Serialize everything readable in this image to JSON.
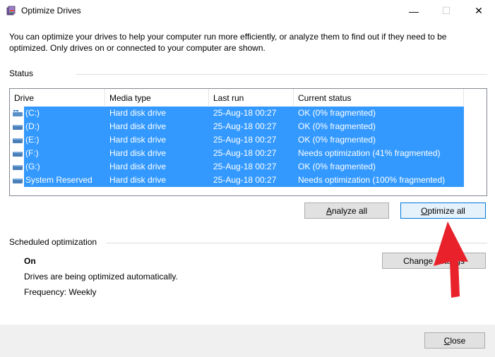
{
  "window": {
    "title": "Optimize Drives",
    "min_glyph": "—",
    "max_glyph": "☐",
    "close_glyph": "✕",
    "accent": "#3399ff",
    "arrow_color": "#e8212b"
  },
  "description": "You can optimize your drives to help your computer run more efficiently, or analyze them to find out if they need to be optimized. Only drives on or connected to your computer are shown.",
  "status": {
    "label": "Status",
    "columns": [
      "Drive",
      "Media type",
      "Last run",
      "Current status"
    ],
    "rows": [
      {
        "drive": "(C:)",
        "media": "Hard disk drive",
        "last_run": "25-Aug-18 00:27",
        "status": "OK (0% fragmented)",
        "icon": "system-drive-icon"
      },
      {
        "drive": "(D:)",
        "media": "Hard disk drive",
        "last_run": "25-Aug-18 00:27",
        "status": "OK (0% fragmented)",
        "icon": "drive-icon"
      },
      {
        "drive": "(E:)",
        "media": "Hard disk drive",
        "last_run": "25-Aug-18 00:27",
        "status": "OK (0% fragmented)",
        "icon": "drive-icon"
      },
      {
        "drive": "(F:)",
        "media": "Hard disk drive",
        "last_run": "25-Aug-18 00:27",
        "status": "Needs optimization (41% fragmented)",
        "icon": "drive-icon"
      },
      {
        "drive": "(G:)",
        "media": "Hard disk drive",
        "last_run": "25-Aug-18 00:27",
        "status": "OK (0% fragmented)",
        "icon": "drive-icon"
      },
      {
        "drive": "System Reserved",
        "media": "Hard disk drive",
        "last_run": "25-Aug-18 00:27",
        "status": "Needs optimization (100% fragmented)",
        "icon": "drive-icon"
      }
    ]
  },
  "buttons": {
    "analyze_all": {
      "accel": "A",
      "rest": "nalyze all"
    },
    "optimize_all": {
      "accel": "O",
      "rest": "ptimize all"
    },
    "change_settings": "Change settings",
    "close": {
      "accel": "C",
      "rest": "lose"
    }
  },
  "scheduled": {
    "label": "Scheduled optimization",
    "state": "On",
    "message": "Drives are being optimized automatically.",
    "frequency": "Frequency: Weekly"
  }
}
